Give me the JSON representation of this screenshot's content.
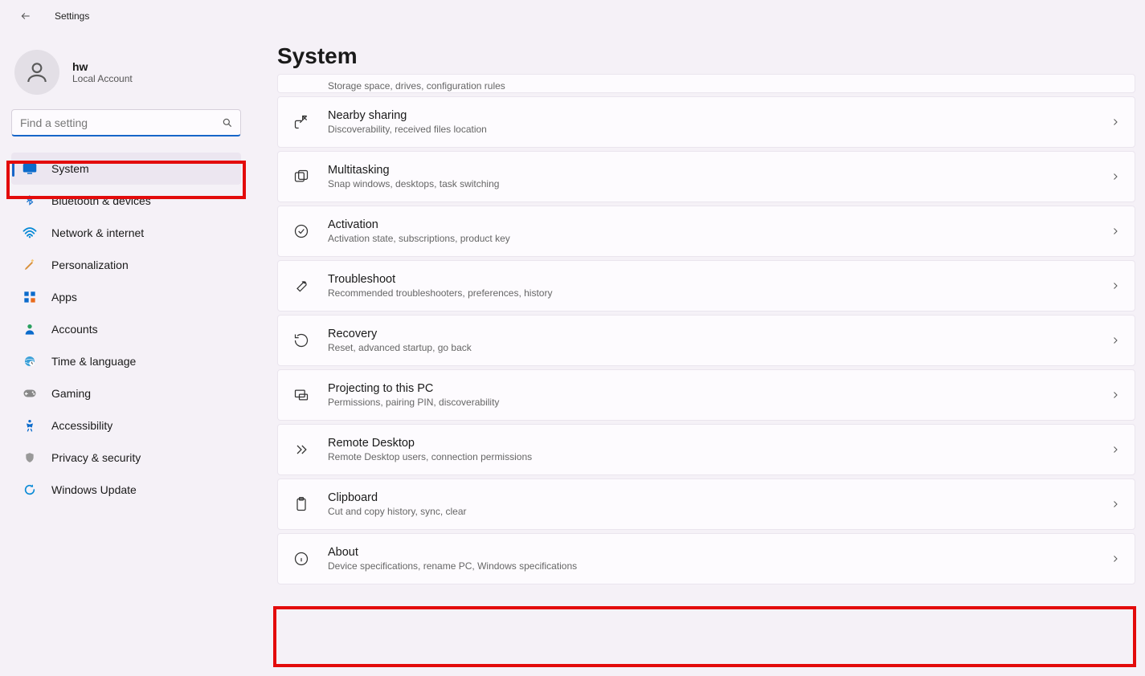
{
  "window": {
    "title": "Settings"
  },
  "user": {
    "name": "hw",
    "subtitle": "Local Account"
  },
  "search": {
    "placeholder": "Find a setting"
  },
  "nav": [
    {
      "key": "system",
      "label": "System",
      "active": true
    },
    {
      "key": "bluetooth",
      "label": "Bluetooth & devices",
      "active": false
    },
    {
      "key": "network",
      "label": "Network & internet",
      "active": false
    },
    {
      "key": "personalization",
      "label": "Personalization",
      "active": false
    },
    {
      "key": "apps",
      "label": "Apps",
      "active": false
    },
    {
      "key": "accounts",
      "label": "Accounts",
      "active": false
    },
    {
      "key": "time",
      "label": "Time & language",
      "active": false
    },
    {
      "key": "gaming",
      "label": "Gaming",
      "active": false
    },
    {
      "key": "accessibility",
      "label": "Accessibility",
      "active": false
    },
    {
      "key": "privacy",
      "label": "Privacy & security",
      "active": false
    },
    {
      "key": "update",
      "label": "Windows Update",
      "active": false
    }
  ],
  "page": {
    "title": "System"
  },
  "cards_partial": {
    "subtitle": "Storage space, drives, configuration rules"
  },
  "cards": [
    {
      "key": "nearby",
      "title": "Nearby sharing",
      "subtitle": "Discoverability, received files location"
    },
    {
      "key": "multitask",
      "title": "Multitasking",
      "subtitle": "Snap windows, desktops, task switching"
    },
    {
      "key": "activation",
      "title": "Activation",
      "subtitle": "Activation state, subscriptions, product key"
    },
    {
      "key": "troubleshoot",
      "title": "Troubleshoot",
      "subtitle": "Recommended troubleshooters, preferences, history"
    },
    {
      "key": "recovery",
      "title": "Recovery",
      "subtitle": "Reset, advanced startup, go back"
    },
    {
      "key": "projecting",
      "title": "Projecting to this PC",
      "subtitle": "Permissions, pairing PIN, discoverability"
    },
    {
      "key": "remote",
      "title": "Remote Desktop",
      "subtitle": "Remote Desktop users, connection permissions"
    },
    {
      "key": "clipboard",
      "title": "Clipboard",
      "subtitle": "Cut and copy history, sync, clear"
    },
    {
      "key": "about",
      "title": "About",
      "subtitle": "Device specifications, rename PC, Windows specifications"
    }
  ]
}
